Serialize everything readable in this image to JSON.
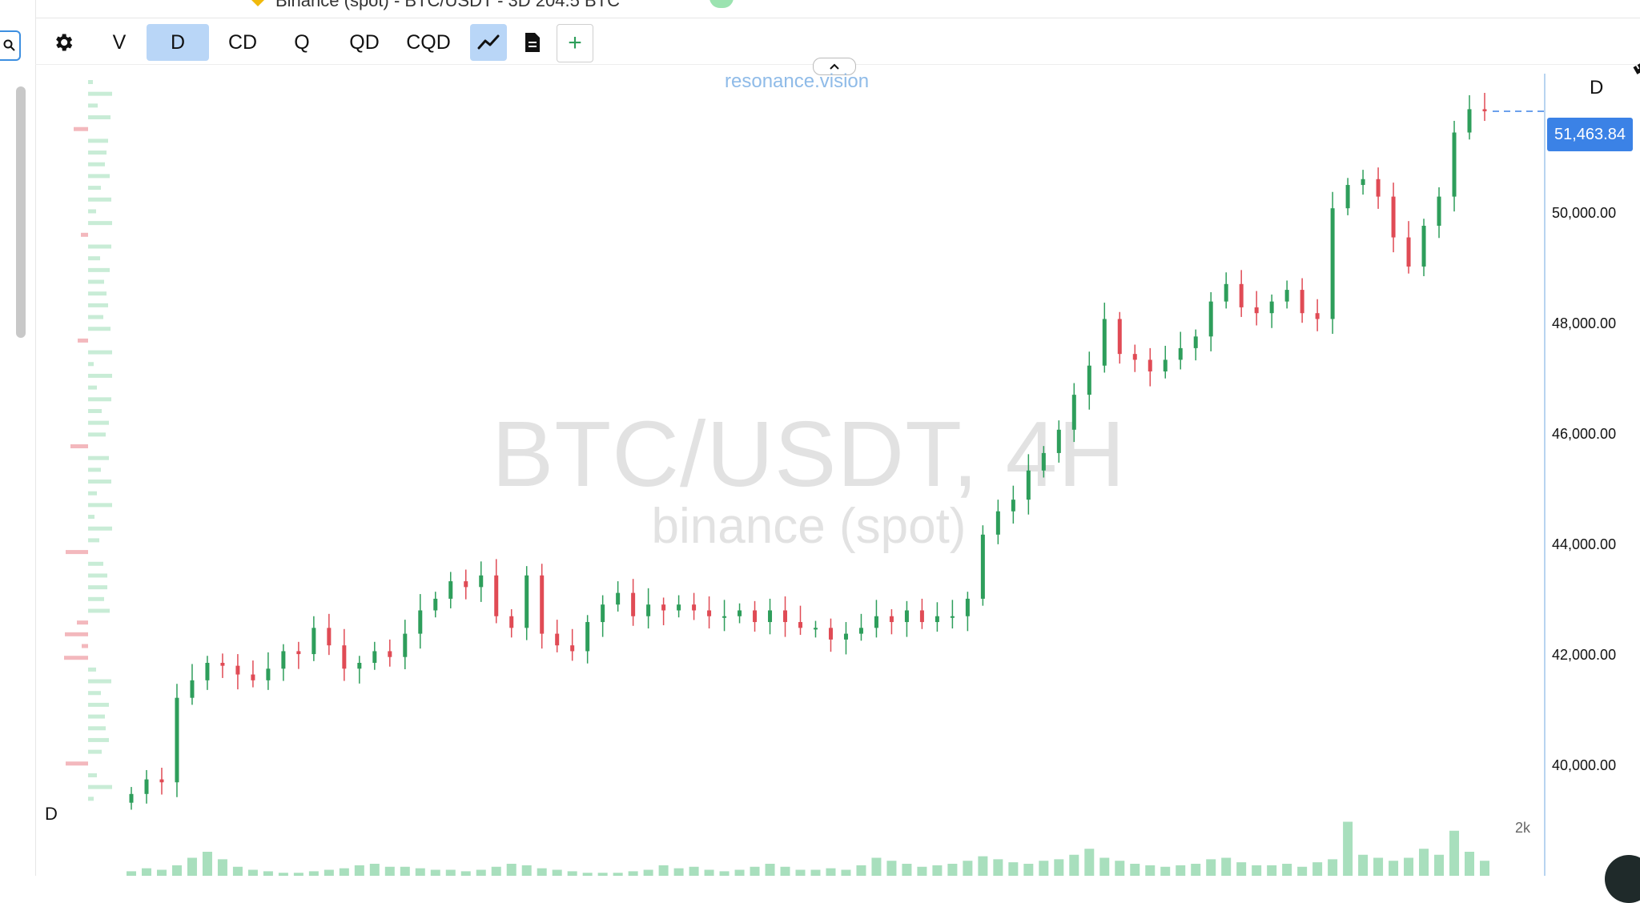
{
  "header": {
    "fragment_title": "Binance (spot) - BTC/USDT - 3D 204.5 BTC"
  },
  "toolbar": {
    "settings_icon": "gear-icon",
    "modes": [
      {
        "label": "V",
        "active": false
      },
      {
        "label": "D",
        "active": true
      },
      {
        "label": "CD",
        "active": false
      },
      {
        "label": "Q",
        "active": false
      },
      {
        "label": "QD",
        "active": false
      },
      {
        "label": "CQD",
        "active": false
      }
    ],
    "line_icon": "line-chart-icon",
    "doc_icon": "document-icon",
    "add_label": "+",
    "ruler_icon": "ruler-icon"
  },
  "chart": {
    "site": "resonance.vision",
    "symbol": "BTC/USDT, 4H",
    "exchange": "binance (spot)",
    "axis_mode": "D",
    "current_price": "51,463.84",
    "price_ticks": [
      "50,000.00",
      "48,000.00",
      "46,000.00",
      "44,000.00",
      "42,000.00",
      "40,000.00"
    ],
    "volume_mode": "D",
    "volume_max": "2k",
    "colors": {
      "up": "#2e9e5b",
      "down": "#e04b55",
      "accent": "#3b82e6"
    }
  },
  "chart_data": {
    "type": "candlestick",
    "title": "BTC/USDT, 4H",
    "subtitle": "binance (spot)",
    "ylim": [
      39500,
      52000
    ],
    "close_series": [
      39750,
      40000,
      39950,
      41400,
      41700,
      42000,
      41950,
      41800,
      41700,
      41900,
      42200,
      42150,
      42600,
      42300,
      41900,
      42000,
      42200,
      42100,
      42500,
      42900,
      43100,
      43400,
      43300,
      43500,
      42800,
      42600,
      43500,
      42500,
      42300,
      42200,
      42700,
      43000,
      43200,
      42800,
      43000,
      42900,
      43000,
      42900,
      42800,
      42800,
      42900,
      42700,
      42900,
      42700,
      42600,
      42600,
      42400,
      42500,
      42600,
      42800,
      42700,
      42900,
      42700,
      42800,
      42800,
      43100,
      44200,
      44600,
      44800,
      45300,
      45600,
      46000,
      46600,
      47100,
      47900,
      47300,
      47200,
      47000,
      47200,
      47400,
      47600,
      48200,
      48500,
      48100,
      48000,
      48200,
      48400,
      48000,
      47900,
      49800,
      50200,
      50300,
      50000,
      49300,
      48800,
      49500,
      50000,
      51100,
      51500,
      51463.84
    ],
    "volume_series": [
      0.15,
      0.25,
      0.2,
      0.35,
      0.6,
      0.8,
      0.55,
      0.3,
      0.2,
      0.15,
      0.1,
      0.1,
      0.15,
      0.2,
      0.25,
      0.35,
      0.4,
      0.3,
      0.3,
      0.25,
      0.2,
      0.2,
      0.15,
      0.2,
      0.3,
      0.4,
      0.35,
      0.25,
      0.2,
      0.15,
      0.1,
      0.1,
      0.1,
      0.15,
      0.2,
      0.35,
      0.25,
      0.3,
      0.2,
      0.15,
      0.2,
      0.3,
      0.4,
      0.3,
      0.2,
      0.2,
      0.25,
      0.2,
      0.35,
      0.6,
      0.5,
      0.4,
      0.3,
      0.35,
      0.4,
      0.5,
      0.65,
      0.55,
      0.45,
      0.4,
      0.5,
      0.55,
      0.7,
      0.9,
      0.6,
      0.5,
      0.4,
      0.35,
      0.3,
      0.35,
      0.4,
      0.55,
      0.6,
      0.45,
      0.35,
      0.35,
      0.4,
      0.3,
      0.45,
      0.55,
      1.8,
      0.7,
      0.6,
      0.5,
      0.6,
      0.9,
      0.7,
      1.5,
      0.8,
      0.5
    ],
    "volume_unit": "BTC"
  }
}
